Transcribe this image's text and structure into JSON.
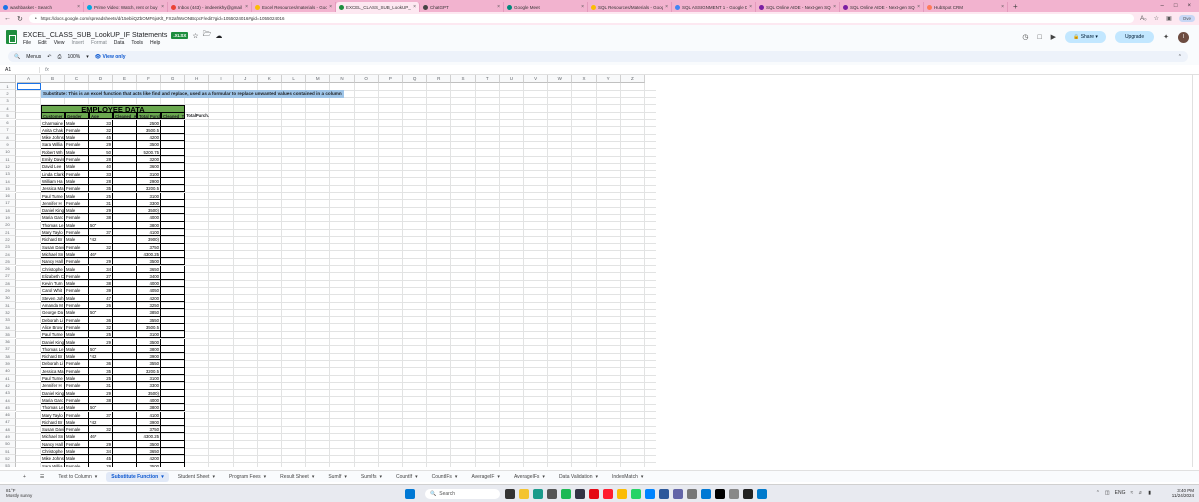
{
  "browser": {
    "tabs": [
      {
        "label": "washbasket - Search",
        "color": "#1a73e8"
      },
      {
        "label": "Prime Video: Watch, rent or buy",
        "color": "#00a8e1"
      },
      {
        "label": "Inbox (443) - imdeenkhy@gmail",
        "color": "#ea4335"
      },
      {
        "label": "Excel Resources/materials - Goo",
        "color": "#fbbc04"
      },
      {
        "label": "EXCEL_CLASS_SUB_LookUP_IF Sta",
        "color": "#1e8e3e"
      },
      {
        "label": "ChatGPT",
        "color": "#444444"
      },
      {
        "label": "Google Meet",
        "color": "#00897b"
      },
      {
        "label": "SQL Resources/Materials - Goog",
        "color": "#fbbc04"
      },
      {
        "label": "SQL ASSIGNMENT 1 - Google Dri",
        "color": "#4285f4"
      },
      {
        "label": "SQL Online AIDE - Next-gen SQL",
        "color": "#7b1fa2"
      },
      {
        "label": "SQL Online AIDE - Next-gen SQL",
        "color": "#7b1fa2"
      },
      {
        "label": "HubSpot CRM",
        "color": "#ff7a59"
      }
    ],
    "url": "https://docs.google.com/spreadsheets/d/15ebiiQZbOMF6jxKlt_FX2afWxONBcpcF/edit?gid=1055024016#gid=1055024016",
    "profile": "Ove"
  },
  "doc": {
    "title": "EXCEL_CLASS_SUB_LookUP_IF Statements",
    "badge": ".XLSX",
    "menu": [
      "File",
      "Edit",
      "View",
      "Insert",
      "Format",
      "Data",
      "Tools",
      "Help"
    ],
    "menu_disabled": [
      false,
      false,
      false,
      true,
      true,
      false,
      false,
      false
    ],
    "share": "Share",
    "upgrade": "Upgrade",
    "avatar": "I",
    "toolbar": {
      "menus": "Menus",
      "zoom": "100%",
      "view_only": "View only"
    },
    "namebox": "A1"
  },
  "columns": [
    "A",
    "B",
    "C",
    "D",
    "E",
    "F",
    "G",
    "H",
    "I",
    "J",
    "K",
    "L",
    "M",
    "N",
    "O",
    "P",
    "Q",
    "R",
    "S",
    "T",
    "U",
    "V",
    "W",
    "X",
    "Y",
    "Z"
  ],
  "banner": "Substitute: This is an excel function that acts like find and replace, used as a formular to replace unwanted values contained in a column",
  "table_title": "EMPLOYEE DATA",
  "headers": [
    "Customer",
    "Gender",
    "Age",
    "Cleaned_A",
    "Total Purch",
    "Cleaned_T",
    "TotalPurch."
  ],
  "rows": [
    [
      "Charmaine E",
      "Male",
      "33",
      "",
      "2500"
    ],
    [
      "Anita Chak",
      "Female",
      "32",
      "",
      "3500.5"
    ],
    [
      "Mike Johns",
      "Male",
      "45",
      "",
      "4200"
    ],
    [
      "Sara Willia",
      "Female",
      "29",
      "",
      "3500"
    ],
    [
      "Robert Wh",
      "Male",
      "50",
      "",
      "5200.75"
    ],
    [
      "Emily Davis",
      "Female",
      "28",
      "",
      "3200"
    ],
    [
      "David Lee",
      "Male",
      "40",
      "",
      "3600"
    ],
    [
      "Linda Clark",
      "Female",
      "33",
      "",
      "3100"
    ],
    [
      "William Ha",
      "Male",
      "28",
      "",
      "2900"
    ],
    [
      "Jessica Ma",
      "Female",
      "35",
      "",
      "3200.5"
    ],
    [
      "Paul Turne",
      "Male",
      "25",
      "",
      "3100"
    ],
    [
      "Jennifer H",
      "Female",
      "31",
      "",
      "3300"
    ],
    [
      "Daniel King",
      "Male",
      "29",
      "",
      "3500)"
    ],
    [
      "Maria Garc",
      "Female",
      "38",
      "",
      "4000"
    ],
    [
      "Thomas Le",
      "Male",
      "50\"",
      "",
      "3800"
    ],
    [
      "Mary Taylo",
      "Female",
      "37",
      "",
      "4100"
    ],
    [
      "Richard Br",
      "Male",
      "*42",
      "",
      "3900)"
    ],
    [
      "Susan Davi",
      "Female",
      "32",
      "",
      "3750"
    ],
    [
      "Michael Sn",
      "Male",
      "46*",
      "",
      "4300.25"
    ],
    [
      "Nancy Hall",
      "Female",
      "29",
      "",
      "3500"
    ],
    [
      "Christophe",
      "Male",
      "34",
      "",
      "3650"
    ],
    [
      "Elizabeth C",
      "Female",
      "27",
      "",
      "3400"
    ],
    [
      "Kevin Turn",
      "Male",
      "38",
      "",
      "4000"
    ],
    [
      "Carol Whit",
      "Female",
      "39",
      "",
      "4050"
    ],
    [
      "Steven Joh",
      "Male",
      "47",
      "",
      "4200"
    ],
    [
      "Amanda M",
      "Female",
      "26",
      "",
      "3250"
    ],
    [
      "George Da",
      "Male",
      "50\"",
      "",
      "3850"
    ],
    [
      "Deborah Li",
      "Female",
      "36",
      "",
      "3550"
    ],
    [
      "Alice Brow",
      "Female",
      "32",
      "",
      "3500.5"
    ],
    [
      "Paul Turne",
      "Male",
      "25",
      "",
      "3100"
    ],
    [
      "Daniel King",
      "Male",
      "29",
      "",
      "3500"
    ],
    [
      "Thomas Le",
      "Male",
      "50\"",
      "",
      "3800"
    ],
    [
      "Richard Br",
      "Male",
      "*42",
      "",
      "3900"
    ],
    [
      "Deborah Li",
      "Female",
      "36",
      "",
      "3550"
    ],
    [
      "Jessica Ma",
      "Female",
      "35",
      "",
      "3200.5"
    ],
    [
      "Paul Turne",
      "Male",
      "25",
      "",
      "3100"
    ],
    [
      "Jennifer H",
      "Female",
      "31",
      "",
      "3300"
    ],
    [
      "Daniel King",
      "Male",
      "29",
      "",
      "3500)"
    ],
    [
      "Maria Garc",
      "Female",
      "38",
      "",
      "4000"
    ],
    [
      "Thomas Le",
      "Male",
      "50\"",
      "",
      "3800"
    ],
    [
      "Mary Taylo",
      "Female",
      "37",
      "",
      "4100"
    ],
    [
      "Richard Br",
      "Male",
      "*42",
      "",
      "3900"
    ],
    [
      "Susan Davi",
      "Female",
      "32",
      "",
      "3750"
    ],
    [
      "Michael Sn",
      "Male",
      "46*",
      "",
      "4300.25"
    ],
    [
      "Nancy Hall",
      "Female",
      "29",
      "",
      "3500"
    ],
    [
      "Christophe",
      "Male",
      "34",
      "",
      "3650"
    ],
    [
      "Mike Johns",
      "Male",
      "45",
      "",
      "4200"
    ],
    [
      "Sara Willia",
      "Female",
      "29",
      "",
      "3500"
    ]
  ],
  "sheets": [
    {
      "label": "Text to Column",
      "active": false
    },
    {
      "label": "Substitute Function",
      "active": true
    },
    {
      "label": "Student Sheet",
      "active": false
    },
    {
      "label": "Program Fees",
      "active": false
    },
    {
      "label": "Result Sheet",
      "active": false
    },
    {
      "label": "SumIf",
      "active": false
    },
    {
      "label": "SumIfs",
      "active": false
    },
    {
      "label": "CountIf",
      "active": false
    },
    {
      "label": "CountIFs",
      "active": false
    },
    {
      "label": "AverageIF",
      "active": false
    },
    {
      "label": "AverageIFs",
      "active": false
    },
    {
      "label": "Data Validation",
      "active": false
    },
    {
      "label": "IndexMatch",
      "active": false
    }
  ],
  "taskbar": {
    "weather_temp": "81°F",
    "weather_desc": "Mostly sunny",
    "search": "Search",
    "lang": "ENG",
    "lang2": "INTL",
    "time": "3:40 PM",
    "date": "11/24/2024"
  }
}
